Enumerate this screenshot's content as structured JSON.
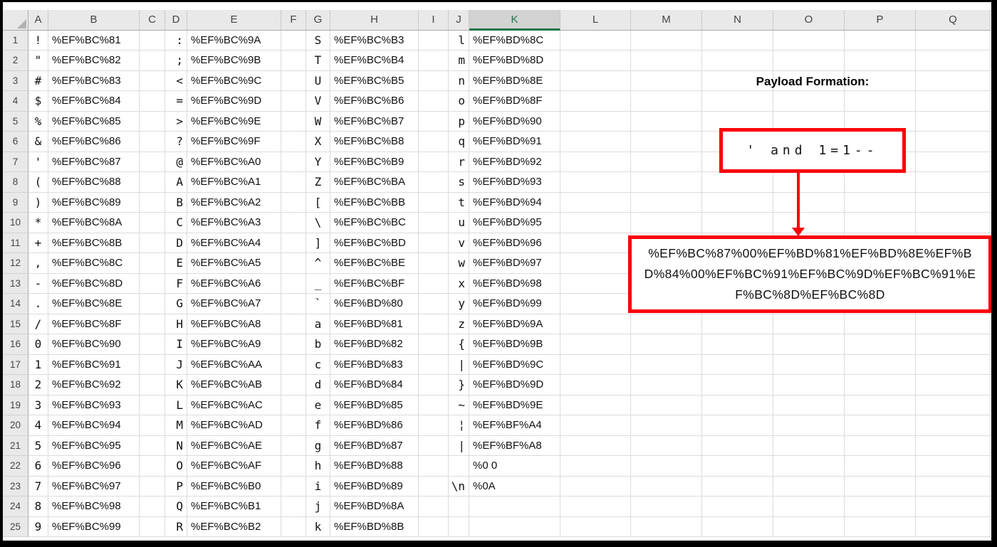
{
  "app": {
    "type": "excel-spreadsheet-view"
  },
  "grid": {
    "column_headers": [
      "A",
      "B",
      "C",
      "D",
      "E",
      "F",
      "G",
      "H",
      "I",
      "J",
      "K",
      "L",
      "M",
      "N",
      "O",
      "P",
      "Q"
    ],
    "selected_column": "K",
    "row_count": 25,
    "rows": [
      {
        "n": "1",
        "A": "!",
        "B": "%EF%BC%81",
        "D": ":",
        "E": "%EF%BC%9A",
        "G": "S",
        "H": "%EF%BC%B3",
        "J": "l",
        "K": "%EF%BD%8C"
      },
      {
        "n": "2",
        "A": "\"",
        "B": "%EF%BC%82",
        "D": ";",
        "E": "%EF%BC%9B",
        "G": "T",
        "H": "%EF%BC%B4",
        "J": "m",
        "K": "%EF%BD%8D"
      },
      {
        "n": "3",
        "A": "#",
        "B": "%EF%BC%83",
        "D": "<",
        "E": "%EF%BC%9C",
        "G": "U",
        "H": "%EF%BC%B5",
        "J": "n",
        "K": "%EF%BD%8E"
      },
      {
        "n": "4",
        "A": "$",
        "B": "%EF%BC%84",
        "D": "=",
        "E": "%EF%BC%9D",
        "G": "V",
        "H": "%EF%BC%B6",
        "J": "o",
        "K": "%EF%BD%8F"
      },
      {
        "n": "5",
        "A": "%",
        "B": "%EF%BC%85",
        "D": ">",
        "E": "%EF%BC%9E",
        "G": "W",
        "H": "%EF%BC%B7",
        "J": "p",
        "K": "%EF%BD%90"
      },
      {
        "n": "6",
        "A": "&",
        "B": "%EF%BC%86",
        "D": "?",
        "E": "%EF%BC%9F",
        "G": "X",
        "H": "%EF%BC%B8",
        "J": "q",
        "K": "%EF%BD%91"
      },
      {
        "n": "7",
        "A": "'",
        "B": "%EF%BC%87",
        "D": "@",
        "E": "%EF%BC%A0",
        "G": "Y",
        "H": "%EF%BC%B9",
        "J": "r",
        "K": "%EF%BD%92"
      },
      {
        "n": "8",
        "A": "(",
        "B": "%EF%BC%88",
        "D": "A",
        "E": "%EF%BC%A1",
        "G": "Z",
        "H": "%EF%BC%BA",
        "J": "s",
        "K": "%EF%BD%93"
      },
      {
        "n": "9",
        "A": ")",
        "B": "%EF%BC%89",
        "D": "B",
        "E": "%EF%BC%A2",
        "G": "[",
        "H": "%EF%BC%BB",
        "J": "t",
        "K": "%EF%BD%94"
      },
      {
        "n": "10",
        "A": "*",
        "B": "%EF%BC%8A",
        "D": "C",
        "E": "%EF%BC%A3",
        "G": "\\",
        "H": "%EF%BC%BC",
        "J": "u",
        "K": "%EF%BD%95"
      },
      {
        "n": "11",
        "A": "+",
        "B": "%EF%BC%8B",
        "D": "D",
        "E": "%EF%BC%A4",
        "G": "]",
        "H": "%EF%BC%BD",
        "J": "v",
        "K": "%EF%BD%96"
      },
      {
        "n": "12",
        "A": ",",
        "B": "%EF%BC%8C",
        "D": "E",
        "E": "%EF%BC%A5",
        "G": "^",
        "H": "%EF%BC%BE",
        "J": "w",
        "K": "%EF%BD%97"
      },
      {
        "n": "13",
        "A": "-",
        "B": "%EF%BC%8D",
        "D": "F",
        "E": "%EF%BC%A6",
        "G": "_",
        "H": "%EF%BC%BF",
        "J": "x",
        "K": "%EF%BD%98"
      },
      {
        "n": "14",
        "A": ".",
        "B": "%EF%BC%8E",
        "D": "G",
        "E": "%EF%BC%A7",
        "G": "`",
        "H": "%EF%BD%80",
        "J": "y",
        "K": "%EF%BD%99"
      },
      {
        "n": "15",
        "A": "/",
        "B": "%EF%BC%8F",
        "D": "H",
        "E": "%EF%BC%A8",
        "G": "a",
        "H": "%EF%BD%81",
        "J": "z",
        "K": "%EF%BD%9A"
      },
      {
        "n": "16",
        "A": "0",
        "B": "%EF%BC%90",
        "D": "I",
        "E": "%EF%BC%A9",
        "G": "b",
        "H": "%EF%BD%82",
        "J": "{",
        "K": "%EF%BD%9B"
      },
      {
        "n": "17",
        "A": "1",
        "B": "%EF%BC%91",
        "D": "J",
        "E": "%EF%BC%AA",
        "G": "c",
        "H": "%EF%BD%83",
        "J": "|",
        "K": "%EF%BD%9C"
      },
      {
        "n": "18",
        "A": "2",
        "B": "%EF%BC%92",
        "D": "K",
        "E": "%EF%BC%AB",
        "G": "d",
        "H": "%EF%BD%84",
        "J": "}",
        "K": "%EF%BD%9D"
      },
      {
        "n": "19",
        "A": "3",
        "B": "%EF%BC%93",
        "D": "L",
        "E": "%EF%BC%AC",
        "G": "e",
        "H": "%EF%BD%85",
        "J": "~",
        "K": "%EF%BD%9E"
      },
      {
        "n": "20",
        "A": "4",
        "B": "%EF%BC%94",
        "D": "M",
        "E": "%EF%BC%AD",
        "G": "f",
        "H": "%EF%BD%86",
        "J": "¦",
        "K": "%EF%BF%A4"
      },
      {
        "n": "21",
        "A": "5",
        "B": "%EF%BC%95",
        "D": "N",
        "E": "%EF%BC%AE",
        "G": "g",
        "H": "%EF%BD%87",
        "J": "|",
        "K": "%EF%BF%A8"
      },
      {
        "n": "22",
        "A": "6",
        "B": "%EF%BC%96",
        "D": "O",
        "E": "%EF%BC%AF",
        "G": "h",
        "H": "%EF%BD%88",
        "J": "",
        "K": "%0 0"
      },
      {
        "n": "23",
        "A": "7",
        "B": "%EF%BC%97",
        "D": "P",
        "E": "%EF%BC%B0",
        "G": "i",
        "H": "%EF%BD%89",
        "J": "\\n",
        "K": "%0A"
      },
      {
        "n": "24",
        "A": "8",
        "B": "%EF%BC%98",
        "D": "Q",
        "E": "%EF%BC%B1",
        "G": "j",
        "H": "%EF%BD%8A",
        "J": "",
        "K": ""
      },
      {
        "n": "25",
        "A": "9",
        "B": "%EF%BC%99",
        "D": "R",
        "E": "%EF%BC%B2",
        "G": "k",
        "H": "%EF%BD%8B",
        "J": "",
        "K": ""
      }
    ]
  },
  "annotation": {
    "title": "Payload Formation:",
    "payload_input": "' and 1=1--",
    "payload_encoded": "%EF%BC%87%00%EF%BD%81%EF%BD%8E%EF%BD%84%00%EF%BC%91%EF%BC%9D%EF%BC%91%EF%BC%8D%EF%BC%8D"
  },
  "colors": {
    "annotation_red": "#FB0207",
    "excel_green": "#217346",
    "header_gray": "#E9E9E9",
    "selected_header_gray": "#D2D2D2",
    "gridline": "#DCDCDC"
  }
}
